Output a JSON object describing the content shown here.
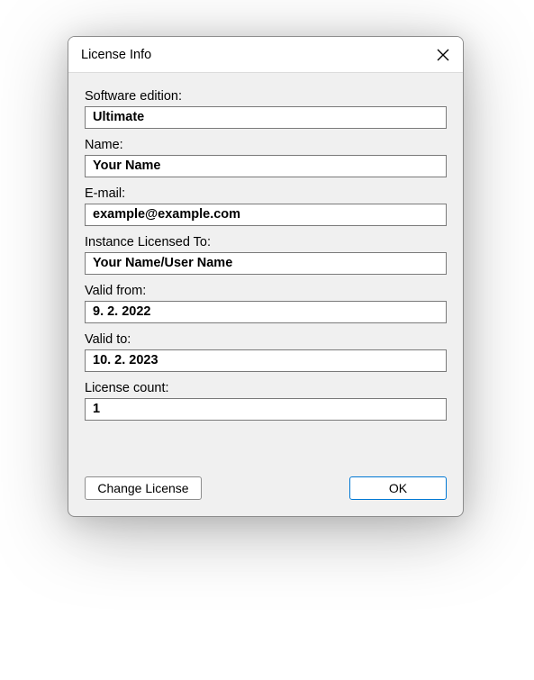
{
  "window": {
    "title": "License Info"
  },
  "fields": {
    "edition": {
      "label": "Software edition:",
      "value": "Ultimate"
    },
    "name": {
      "label": "Name:",
      "value": "Your Name"
    },
    "email": {
      "label": "E-mail:",
      "value": "example@example.com"
    },
    "licensedTo": {
      "label": "Instance Licensed To:",
      "value": "Your Name/User Name"
    },
    "validFrom": {
      "label": "Valid from:",
      "value": "9. 2. 2022"
    },
    "validTo": {
      "label": "Valid to:",
      "value": "10. 2. 2023"
    },
    "licenseCount": {
      "label": "License count:",
      "value": "1"
    }
  },
  "buttons": {
    "change": "Change License",
    "ok": "OK"
  }
}
